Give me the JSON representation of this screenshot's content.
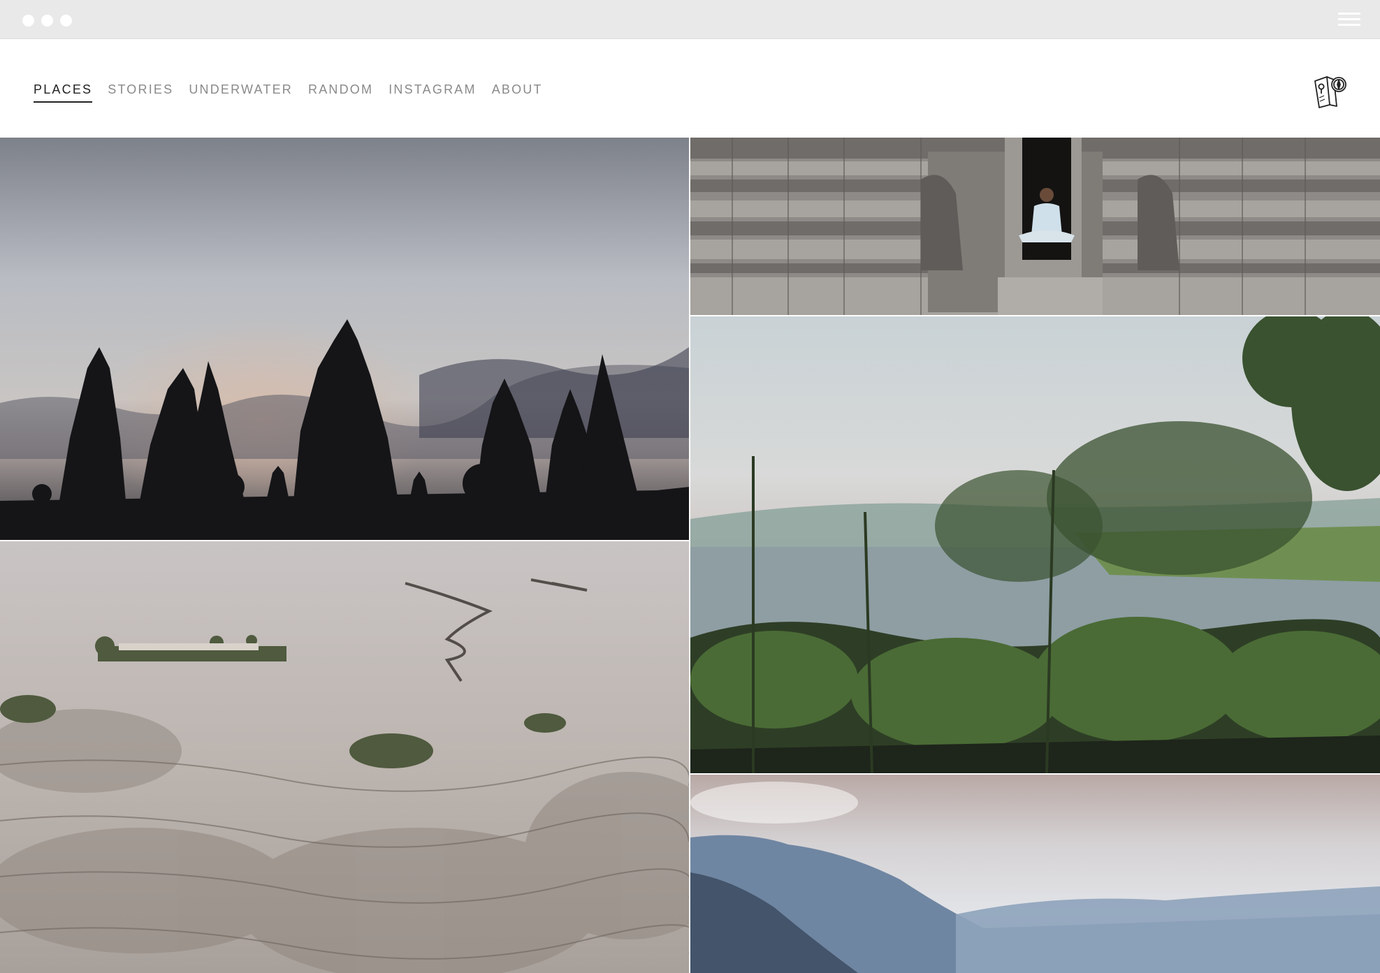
{
  "nav": {
    "items": [
      {
        "label": "PLACES",
        "active": true
      },
      {
        "label": "STORIES",
        "active": false
      },
      {
        "label": "UNDERWATER",
        "active": false
      },
      {
        "label": "RANDOM",
        "active": false
      },
      {
        "label": "INSTAGRAM",
        "active": false
      },
      {
        "label": "ABOUT",
        "active": false
      }
    ]
  },
  "logo": {
    "icon": "map-compass-icon"
  },
  "gallery": {
    "photos": [
      {
        "name": "temple-silhouette-photo"
      },
      {
        "name": "temple-doorway-photo"
      },
      {
        "name": "river-jungle-photo"
      },
      {
        "name": "volcanic-plain-photo"
      },
      {
        "name": "misty-mountains-photo"
      }
    ]
  },
  "colors": {
    "chrome": "#e9e9e9",
    "nav_active": "#222222",
    "nav_inactive": "#8a8a8a"
  }
}
